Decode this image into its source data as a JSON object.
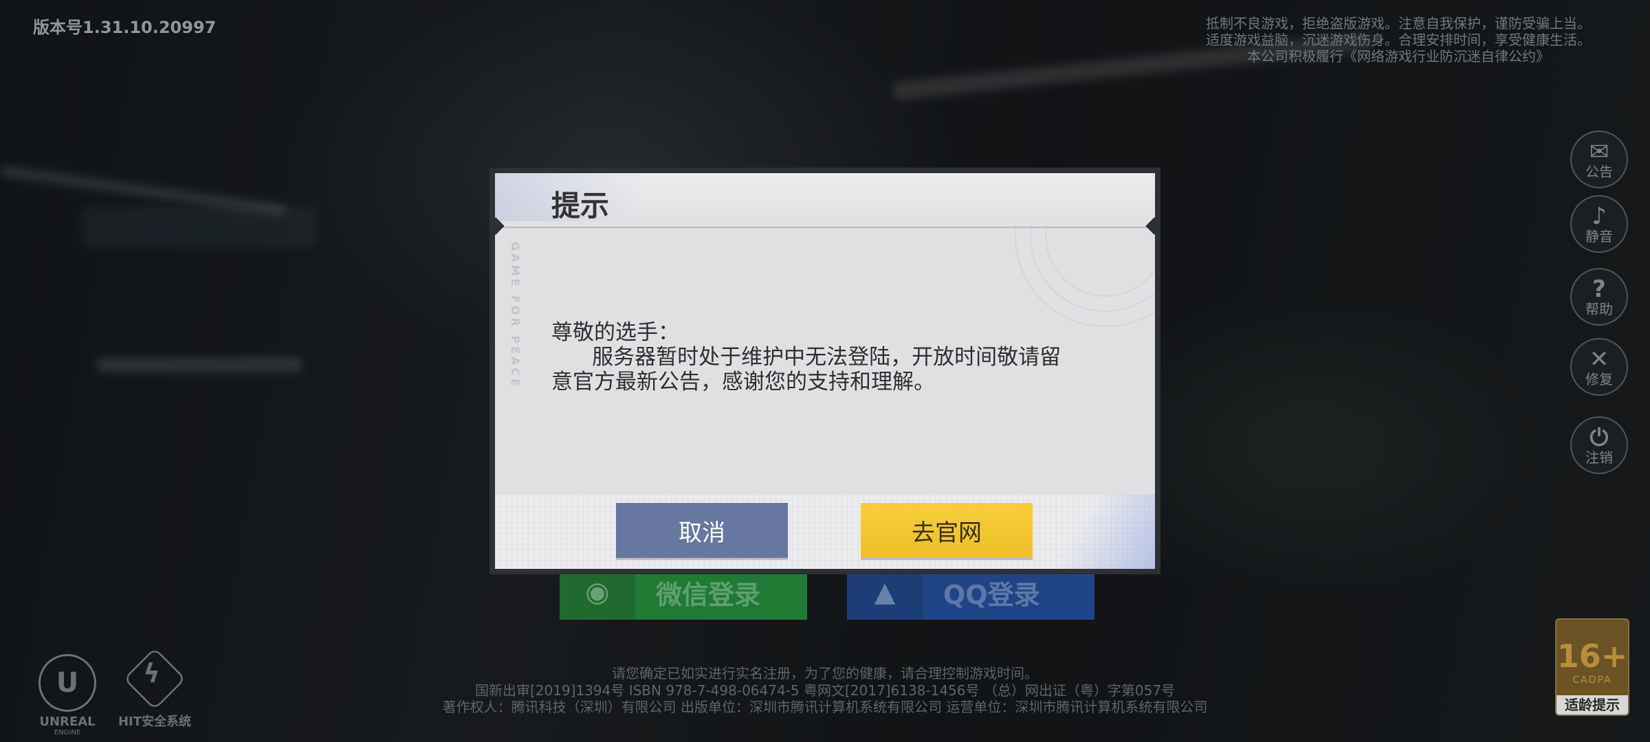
{
  "top": {
    "version": "版本号1.31.10.20997",
    "notice_lines": [
      "抵制不良游戏，拒绝盗版游戏。注意自我保护，谨防受骗上当。",
      "适度游戏益脑，沉迷游戏伤身。合理安排时间，享受健康生活。",
      "本公司积极履行《网络游戏行业防沉迷自律公约》"
    ]
  },
  "side_buttons": [
    {
      "icon": "megaphone-icon",
      "glyph": "✉",
      "label": "公告"
    },
    {
      "icon": "speaker-icon",
      "glyph": "♪",
      "label": "静音"
    },
    {
      "icon": "question-icon",
      "glyph": "?",
      "label": "帮助"
    },
    {
      "icon": "wrench-icon",
      "glyph": "✕",
      "label": "修复"
    },
    {
      "icon": "power-icon",
      "glyph": "⏻",
      "label": "注销"
    }
  ],
  "login": {
    "wechat_label": "微信登录",
    "qq_label": "QQ登录"
  },
  "footer": {
    "lines": [
      "请您确定已如实进行实名注册，为了您的健康，请合理控制游戏时间。",
      "国新出审[2019]1394号  ISBN 978-7-498-06474-5  粤网文[2017]6138-1456号  （总）网出证（粤）字第057号",
      "著作权人：腾讯科技（深圳）有限公司  出版单位：深圳市腾讯计算机系统有限公司  运营单位：深圳市腾讯计算机系统有限公司"
    ],
    "logos": {
      "unreal": "UNREAL",
      "unreal_sub": "ENGINE",
      "hit": "HIT安全系统"
    },
    "age": {
      "rating": "16+",
      "org": "CADPA",
      "label": "适龄提示"
    }
  },
  "dialog": {
    "title": "提示",
    "side_text": "GAME FOR PEACE",
    "body": [
      "尊敬的选手：",
      "      服务器暂时处于维护中无法登陆，开放时间敬请留",
      "意官方最新公告，感谢您的支持和理解。"
    ],
    "cancel_label": "取消",
    "go_label": "去官网"
  }
}
